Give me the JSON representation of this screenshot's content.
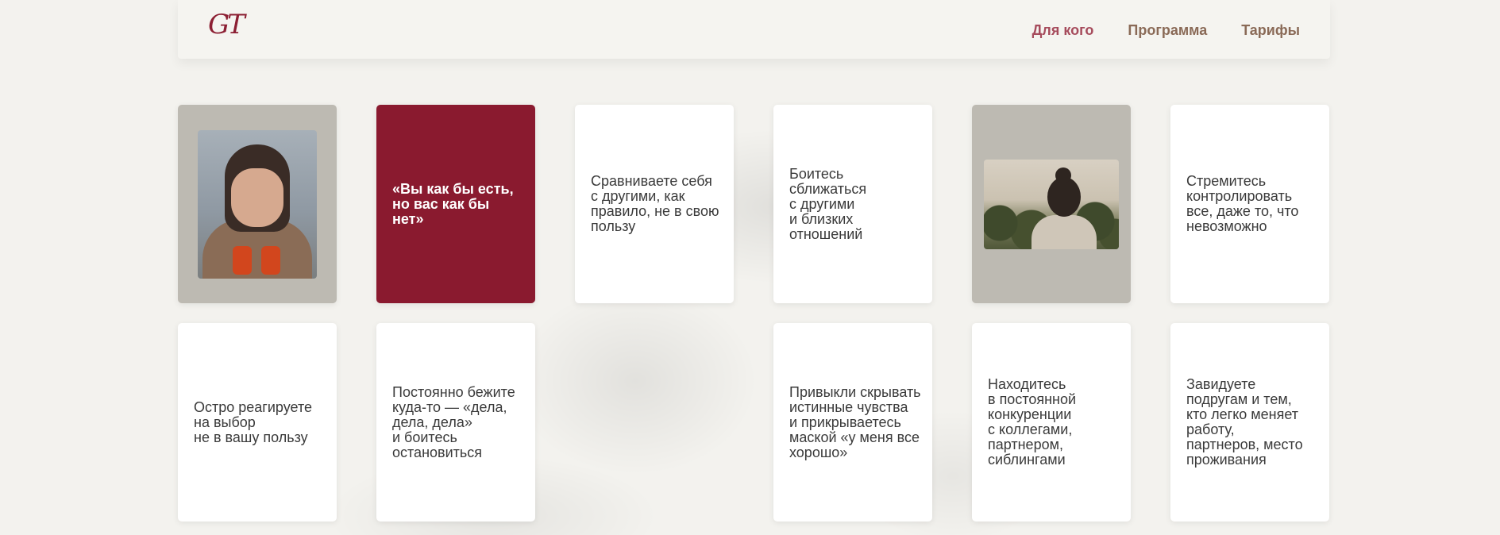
{
  "header": {
    "logo": "GT",
    "nav": [
      {
        "label": "Для кого",
        "active": true
      },
      {
        "label": "Программа",
        "active": false
      },
      {
        "label": "Тарифы",
        "active": false
      }
    ]
  },
  "colors": {
    "accent": "#8a1a2f",
    "nav_active": "#a64b5c",
    "nav": "#8a6a57",
    "background": "#f3f2ee",
    "card_grey": "#bdbab2"
  },
  "cards": [
    {
      "type": "image",
      "icon": "person-covering-face-photo"
    },
    {
      "type": "quote",
      "text": "«Вы как бы есть,\nно вас как бы нет»"
    },
    {
      "type": "text",
      "text": "Сравниваете себя\nс другими, как\nправило, не в свою\nпользу"
    },
    {
      "type": "text",
      "text": "Боитесь\nсближаться\nс другими\nи близких\nотношений"
    },
    {
      "type": "image",
      "icon": "woman-back-nature-photo"
    },
    {
      "type": "text",
      "text": "Стремитесь\nконтролировать\nвсе, даже то, что\nневозможно"
    },
    {
      "type": "text",
      "text": "Остро реагируете\nна выбор\nне в вашу пользу"
    },
    {
      "type": "text",
      "text": "Постоянно бежите\nкуда-то — «дела,\nдела, дела»\nи боитесь\nостановиться"
    },
    {
      "type": "text",
      "text": "Привыкли скрывать\nистинные чувства\nи прикрываетесь\nмаской «у меня все\nхорошо»"
    },
    {
      "type": "text",
      "text": "Находитесь\nв постоянной\nконкуренции\nс коллегами,\nпартнером,\nсиблингами"
    },
    {
      "type": "text",
      "text": "Завидуете\nподругам и тем,\nкто легко меняет\nработу,\nпартнеров, место\nпроживания"
    }
  ]
}
